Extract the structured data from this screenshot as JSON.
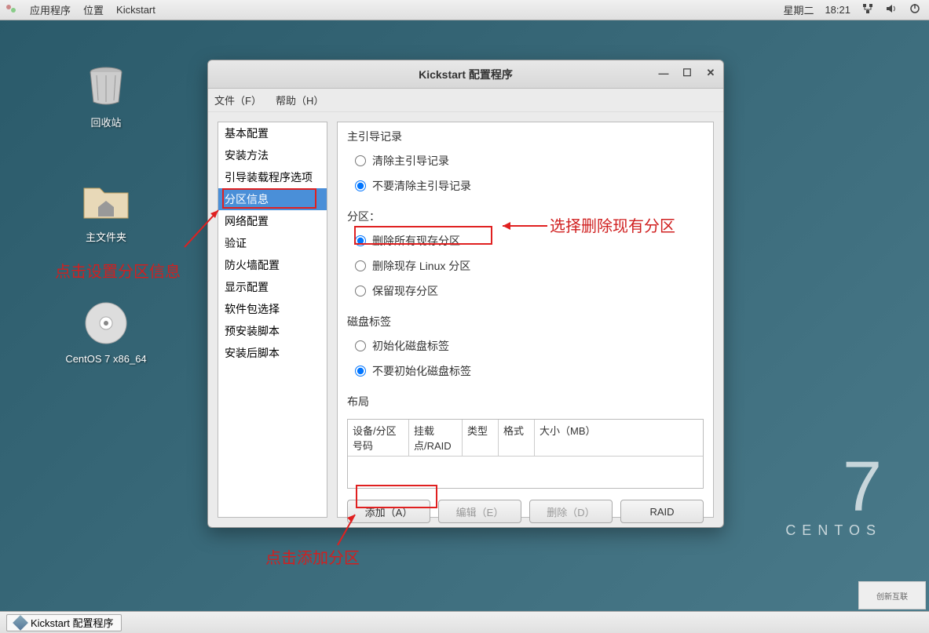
{
  "panel": {
    "apps": "应用程序",
    "places": "位置",
    "kickstart": "Kickstart",
    "day": "星期二",
    "time": "18:21"
  },
  "desktop": {
    "trash": "回收站",
    "home": "主文件夹",
    "disc": "CentOS 7 x86_64"
  },
  "window": {
    "title": "Kickstart 配置程序",
    "menu_file": "文件（F）",
    "menu_help": "帮助（H）"
  },
  "sidebar": {
    "items": [
      "基本配置",
      "安装方法",
      "引导装载程序选项",
      "分区信息",
      "网络配置",
      "验证",
      "防火墙配置",
      "显示配置",
      "软件包选择",
      "预安装脚本",
      "安装后脚本"
    ],
    "selected_index": 3
  },
  "main": {
    "mbr_label": "主引导记录",
    "mbr_clear": "清除主引导记录",
    "mbr_keep": "不要清除主引导记录",
    "part_label": "分区：",
    "part_remove_all": "删除所有现存分区",
    "part_remove_linux": "删除现存 Linux 分区",
    "part_keep": "保留现存分区",
    "disk_label_label": "磁盘标签",
    "disk_init": "初始化磁盘标签",
    "disk_noinit": "不要初始化磁盘标签",
    "layout_label": "布局",
    "col_device": "设备/分区号码",
    "col_mount": "挂载点/RAID",
    "col_type": "类型",
    "col_format": "格式",
    "col_size": "大小（MB）",
    "btn_add": "添加（A）",
    "btn_edit": "编辑（E）",
    "btn_delete": "删除（D）",
    "btn_raid": "RAID"
  },
  "anno": {
    "left": "点击设置分区信息",
    "right": "选择删除现有分区",
    "bottom": "点击添加分区"
  },
  "taskbar": {
    "item": "Kickstart 配置程序"
  },
  "centos": {
    "num": "7",
    "name": "CENTOS"
  },
  "watermark": "创新互联"
}
